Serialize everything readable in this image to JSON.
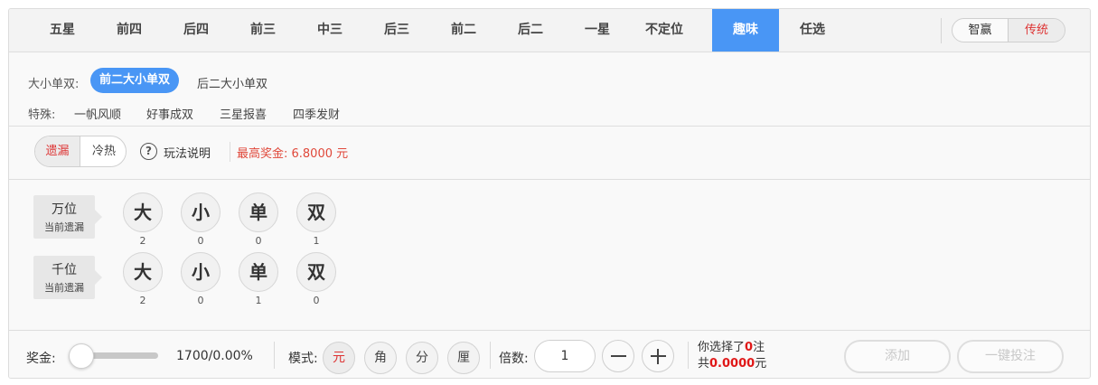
{
  "tabs": [
    "五星",
    "前四",
    "后四",
    "前三",
    "中三",
    "后三",
    "前二",
    "后二",
    "一星",
    "不定位",
    "趣味",
    "任选"
  ],
  "active_tab": "趣味",
  "mode_toggle": {
    "left": "智赢",
    "right": "传统",
    "active": "传统"
  },
  "sub_groups": {
    "daxiao_label": "大小单双:",
    "daxiao_items": [
      "前二大小单双",
      "后二大小单双"
    ],
    "daxiao_active": "前二大小单双",
    "special_label": "特殊:",
    "special_items": [
      "一帆风顺",
      "好事成双",
      "三星报喜",
      "四季发财"
    ]
  },
  "options": {
    "miss_label": "遗漏",
    "hot_label": "冷热",
    "help_icon": "?",
    "help_label": "玩法说明",
    "max_prize": "最高奖金: 6.8000 元"
  },
  "rows": [
    {
      "name": "万位",
      "sub": "当前遗漏",
      "balls": [
        "大",
        "小",
        "单",
        "双"
      ],
      "miss": [
        "2",
        "0",
        "0",
        "1"
      ]
    },
    {
      "name": "千位",
      "sub": "当前遗漏",
      "balls": [
        "大",
        "小",
        "单",
        "双"
      ],
      "miss": [
        "2",
        "0",
        "1",
        "0"
      ]
    }
  ],
  "bottom": {
    "prize_label": "奖金:",
    "prize_value": "1700/0.00%",
    "slider_level": 0,
    "mode_label": "模式:",
    "units": [
      "元",
      "角",
      "分",
      "厘"
    ],
    "active_unit": "元",
    "multiple_label": "倍数:",
    "multiple_value": "1",
    "selected_prefix": "你选择了",
    "selected_count": "0",
    "selected_suffix": "注",
    "total_prefix": "共",
    "total_amount": "0.0000",
    "total_suffix": "元",
    "add_button": "添加",
    "quick_bet_button": "一键投注"
  },
  "colors": {
    "accent": "#4996f5",
    "highlight": "#e0483a"
  }
}
